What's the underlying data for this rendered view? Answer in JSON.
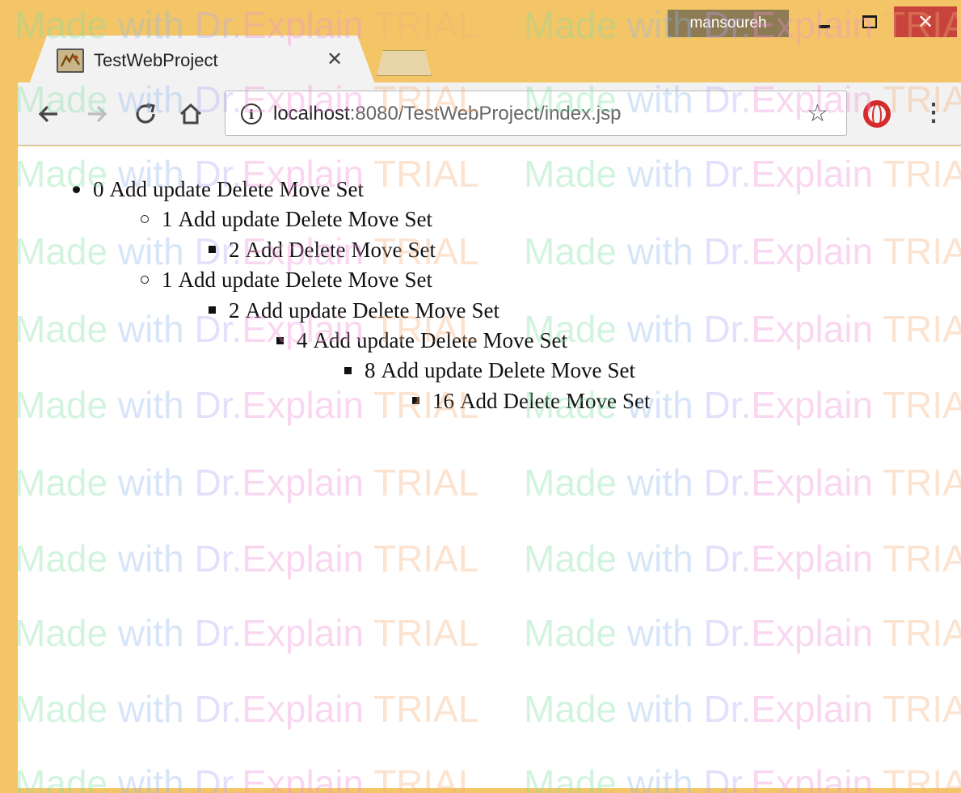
{
  "window": {
    "user": "mansoureh",
    "close_glyph": "✕"
  },
  "tab": {
    "title": "TestWebProject",
    "close_glyph": "✕"
  },
  "toolbar": {
    "url_host": "localhost",
    "url_rest": ":8080/TestWebProject/index.jsp",
    "icons": [
      "back-arrow-icon",
      "forward-arrow-icon",
      "reload-icon",
      "home-icon",
      "info-icon",
      "bookmark-star-icon",
      "opera-icon",
      "menu-dots-icon"
    ]
  },
  "tree": [
    {
      "level": 0,
      "bullet": "disc",
      "num": "0",
      "actions": [
        "Add",
        "update",
        "Delete",
        "Move",
        "Set"
      ]
    },
    {
      "level": 1,
      "bullet": "circle",
      "num": "1",
      "actions": [
        "Add",
        "update",
        "Delete",
        "Move",
        "Set"
      ]
    },
    {
      "level": 2,
      "bullet": "square",
      "num": "2",
      "actions": [
        "Add",
        "",
        "Delete",
        "Move",
        "Set"
      ]
    },
    {
      "level": 1,
      "bullet": "circle",
      "num": "1",
      "actions": [
        "Add",
        "update",
        "Delete",
        "Move",
        "Set"
      ]
    },
    {
      "level": 2,
      "bullet": "square",
      "num": "2",
      "actions": [
        "Add",
        "update",
        "Delete",
        "Move",
        "Set"
      ]
    },
    {
      "level": 3,
      "bullet": "square",
      "num": "4",
      "actions": [
        "Add",
        "update",
        "Delete",
        "Move",
        "Set"
      ]
    },
    {
      "level": 4,
      "bullet": "square",
      "num": "8",
      "actions": [
        "Add",
        "update",
        "Delete",
        "Move",
        "Set"
      ]
    },
    {
      "level": 5,
      "bullet": "square",
      "num": "16",
      "actions": [
        "Add",
        "",
        "Delete",
        "Move",
        "Set"
      ]
    }
  ],
  "watermark": {
    "parts": [
      "Made ",
      "with ",
      "Dr.",
      "Explain ",
      "TRIAL"
    ]
  },
  "colors": {
    "frame": "#f3c566",
    "close_button": "#c7433c",
    "opera_red": "#d62b2b"
  }
}
